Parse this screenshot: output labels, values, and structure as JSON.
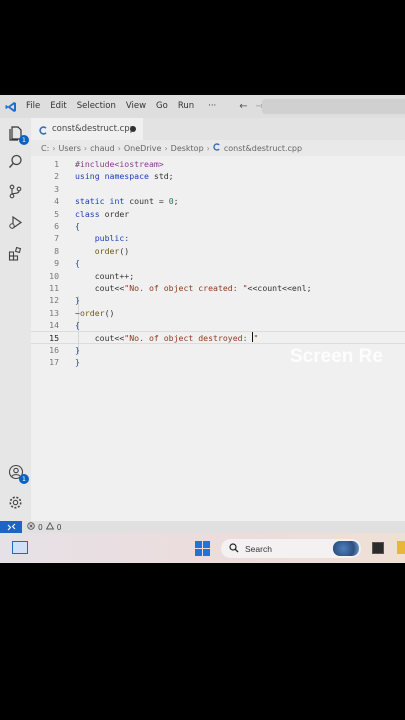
{
  "menu": {
    "items": [
      "File",
      "Edit",
      "Selection",
      "View",
      "Go",
      "Run"
    ],
    "more": "···",
    "back": "←",
    "forward": "→"
  },
  "activity": {
    "explorer_badge": "1",
    "accounts_badge": "1"
  },
  "tab": {
    "filename": "const&destruct.cpp",
    "modified": true
  },
  "breadcrumb": [
    "C:",
    "Users",
    "chaud",
    "OneDrive",
    "Desktop",
    "const&destruct.cpp"
  ],
  "editor": {
    "active_line": 15,
    "lines": [
      {
        "n": "1",
        "tokens": [
          [
            "pp",
            "#include<iostream>"
          ]
        ]
      },
      {
        "n": "2",
        "tokens": [
          [
            "kw",
            "using"
          ],
          [
            "",
            " "
          ],
          [
            "kw",
            "namespace"
          ],
          [
            "",
            " std;"
          ]
        ]
      },
      {
        "n": "3",
        "tokens": []
      },
      {
        "n": "4",
        "tokens": [
          [
            "kw",
            "static"
          ],
          [
            "",
            " "
          ],
          [
            "kw",
            "int"
          ],
          [
            "",
            " count = "
          ],
          [
            "num",
            "0"
          ],
          [
            "",
            ";"
          ]
        ]
      },
      {
        "n": "5",
        "tokens": [
          [
            "kw",
            "class"
          ],
          [
            "",
            " order"
          ]
        ]
      },
      {
        "n": "6",
        "tokens": [
          [
            "br",
            "{"
          ]
        ]
      },
      {
        "n": "7",
        "tokens": [
          [
            "",
            "    "
          ],
          [
            "kw",
            "public:"
          ]
        ]
      },
      {
        "n": "8",
        "tokens": [
          [
            "",
            "    "
          ],
          [
            "fn",
            "order"
          ],
          [
            "",
            "()"
          ]
        ]
      },
      {
        "n": "9",
        "tokens": [
          [
            "br",
            "{"
          ]
        ]
      },
      {
        "n": "10",
        "tokens": [
          [
            "",
            "    count++;"
          ]
        ]
      },
      {
        "n": "11",
        "tokens": [
          [
            "",
            "    cout<<"
          ],
          [
            "str",
            "\"No. of object created: \""
          ],
          [
            "",
            "<<count<<enl;"
          ]
        ]
      },
      {
        "n": "12",
        "tokens": [
          [
            "br",
            "}"
          ]
        ]
      },
      {
        "n": "13",
        "tokens": [
          [
            "",
            "~"
          ],
          [
            "fn",
            "order"
          ],
          [
            "",
            "()"
          ]
        ]
      },
      {
        "n": "14",
        "tokens": [
          [
            "br",
            "{"
          ]
        ]
      },
      {
        "n": "15",
        "tokens": [
          [
            "",
            "    cout<<"
          ],
          [
            "str",
            "\"No. of object destroyed: "
          ]
        ],
        "cursor_after": "\""
      },
      {
        "n": "16",
        "tokens": [
          [
            "br",
            "}"
          ]
        ]
      },
      {
        "n": "17",
        "tokens": [
          [
            "br",
            "}"
          ]
        ]
      }
    ]
  },
  "watermark": "Screen Re",
  "status": {
    "remote_icon": "remote-icon",
    "errors": "0",
    "warnings": "0"
  },
  "taskbar": {
    "search_label": "Search"
  }
}
